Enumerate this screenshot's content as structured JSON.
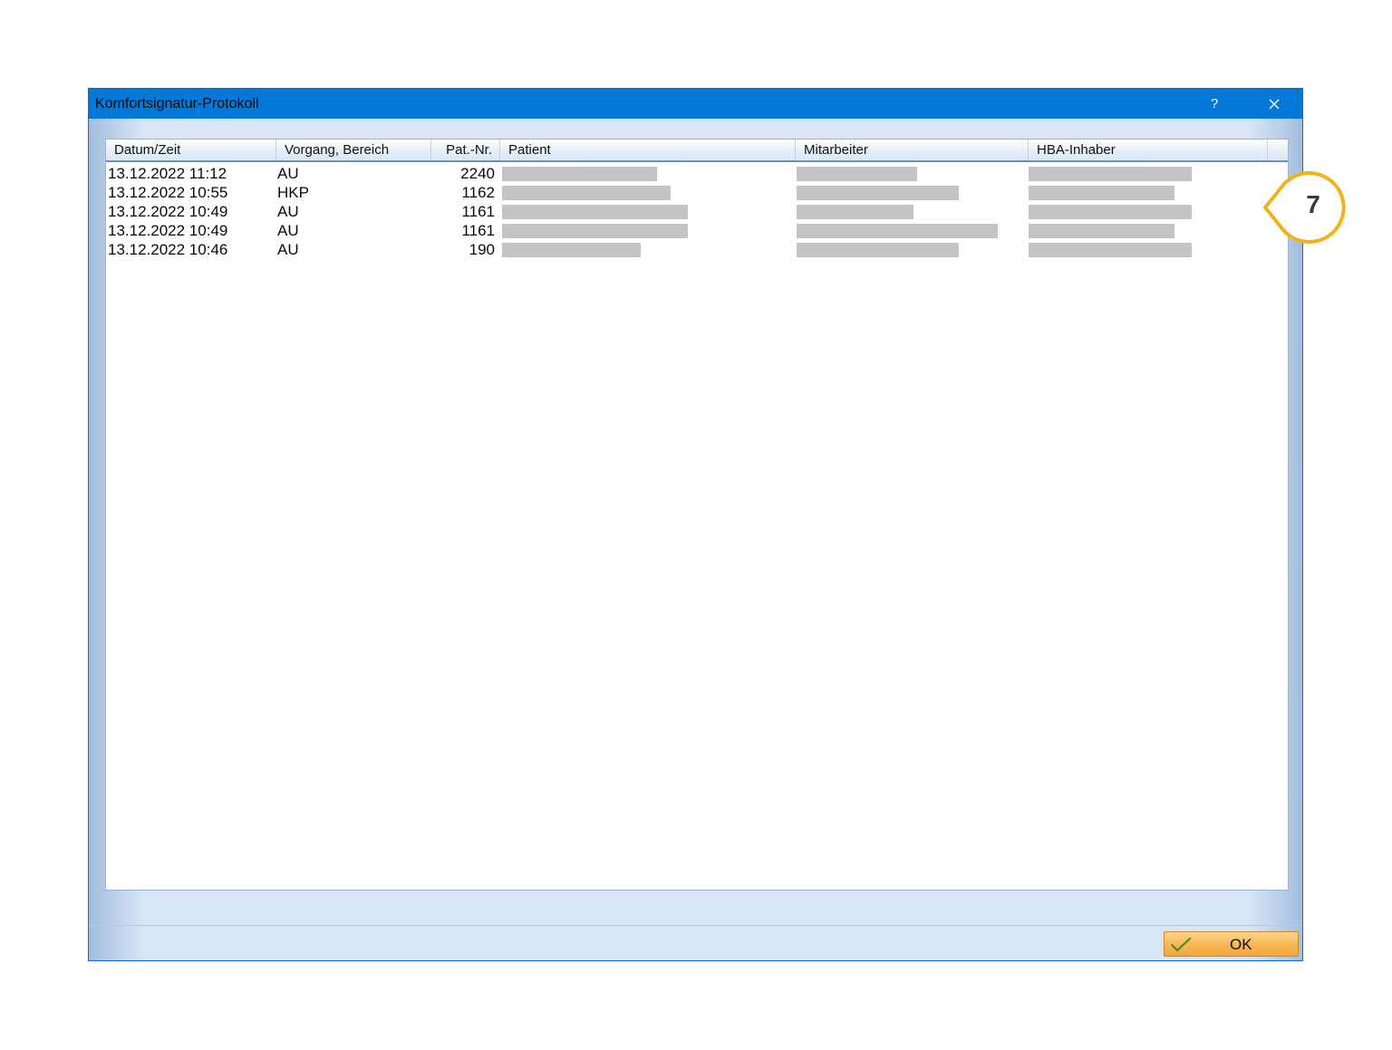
{
  "window": {
    "title": "Komfortsignatur-Protokoll",
    "help_label": "?",
    "ok_label": "OK"
  },
  "table": {
    "columns": [
      "Datum/Zeit",
      "Vorgang, Bereich",
      "Pat.-Nr.",
      "Patient",
      "Mitarbeiter",
      "HBA-Inhaber"
    ],
    "rows": [
      {
        "datum": "13.12.2022 11:12",
        "vorgang": "AU",
        "patnr": "2240"
      },
      {
        "datum": "13.12.2022 10:55",
        "vorgang": "HKP",
        "patnr": "1162"
      },
      {
        "datum": "13.12.2022 10:49",
        "vorgang": "AU",
        "patnr": "1161"
      },
      {
        "datum": "13.12.2022 10:49",
        "vorgang": "AU",
        "patnr": "1161"
      },
      {
        "datum": "13.12.2022 10:46",
        "vorgang": "AU",
        "patnr": "190"
      }
    ]
  },
  "callout": {
    "number": "7",
    "color": "#f2b21c"
  },
  "icons": {
    "close": "close-icon",
    "ok": "checkmark-icon"
  },
  "colors": {
    "titlebar": "#0478d7",
    "redaction": "#c4c4c4",
    "ok_button": "#f8b653"
  }
}
